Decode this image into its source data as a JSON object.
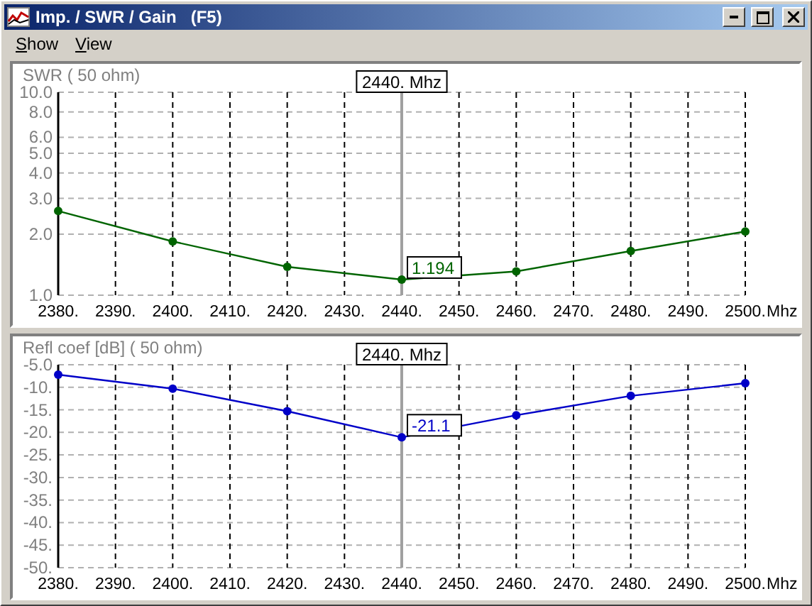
{
  "window": {
    "title": "Imp. / SWR / Gain   (F5)"
  },
  "menu": [
    {
      "label": "Show"
    },
    {
      "label": "View"
    }
  ],
  "panels": [
    {
      "kind": "log_plot",
      "title": "SWR ( 50 ohm)",
      "y_labels": [
        "10.0",
        "8.0",
        "6.0",
        "5.0",
        "4.0",
        "3.0",
        "2.0",
        "1.0"
      ],
      "x_labels": [
        "2380.",
        "2390.",
        "2400.",
        "2410.",
        "2420.",
        "2430.",
        "2440.",
        "2450.",
        "2460.",
        "2470.",
        "2480.",
        "2490.",
        "2500."
      ],
      "unit": "Mhz",
      "cursor_label": "2440. Mhz",
      "value_label": "1.194",
      "color": "#006400"
    },
    {
      "kind": "chart",
      "chart_data": {
        "type": "line",
        "title": "Refl coef [dB] ( 50 ohm)",
        "xlabel": "Mhz",
        "grid": true,
        "x": [
          2380,
          2400,
          2420,
          2440,
          2460,
          2480,
          2500
        ],
        "series": [
          {
            "color": "#0000c8",
            "marker": "o",
            "values": [
              -7.2,
              -10.3,
              -15.3,
              -21.1,
              -16.2,
              -11.9,
              -9.1
            ]
          }
        ],
        "xlim": [
          2380,
          2500
        ],
        "ylim": [
          -50,
          -5
        ],
        "xticks": [
          {
            "value": 2380,
            "label": "2380."
          },
          {
            "value": 2390,
            "label": "2390."
          },
          {
            "value": 2400,
            "label": "2400."
          },
          {
            "value": 2410,
            "label": "2410."
          },
          {
            "value": 2420,
            "label": "2420."
          },
          {
            "value": 2430,
            "label": "2430."
          },
          {
            "value": 2440,
            "label": "2440."
          },
          {
            "value": 2450,
            "label": "2450."
          },
          {
            "value": 2460,
            "label": "2460."
          },
          {
            "value": 2470,
            "label": "2470."
          },
          {
            "value": 2480,
            "label": "2480."
          },
          {
            "value": 2490,
            "label": "2490."
          },
          {
            "value": 2500,
            "label": "2500."
          }
        ],
        "yticks": [
          {
            "value": -5,
            "label": "-5.0"
          },
          {
            "value": -10,
            "label": "-10."
          },
          {
            "value": -15,
            "label": "-15."
          },
          {
            "value": -20,
            "label": "-20."
          },
          {
            "value": -25,
            "label": "-25."
          },
          {
            "value": -30,
            "label": "-30."
          },
          {
            "value": -35,
            "label": "-35."
          },
          {
            "value": -40,
            "label": "-40."
          },
          {
            "value": -45,
            "label": "-45."
          },
          {
            "value": -50,
            "label": "-50."
          }
        ],
        "annotations": [
          {
            "x": 2440,
            "text": "2440. Mhz"
          },
          {
            "x": 2440,
            "y": -21.1,
            "text": "-21.1"
          }
        ]
      }
    }
  ]
}
